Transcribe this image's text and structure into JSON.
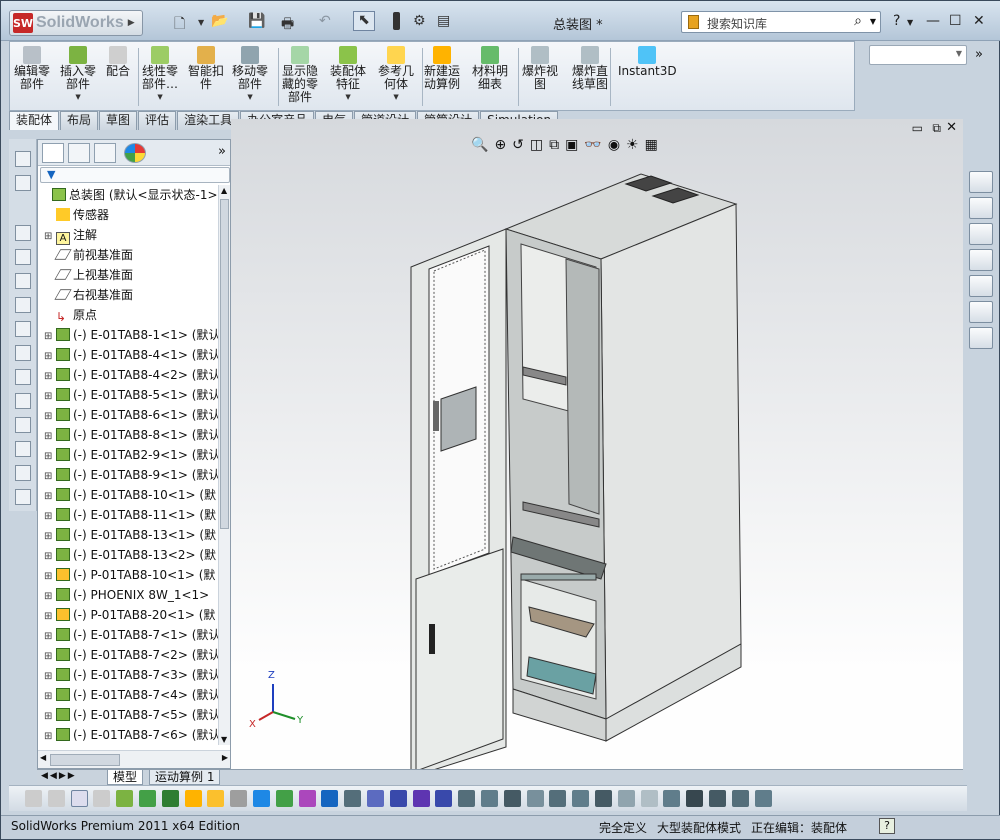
{
  "app": {
    "logo_text": "SolidWorks",
    "logo_mark": "SW",
    "doc_title": "总装图 *"
  },
  "search": {
    "placeholder": "搜索知识库"
  },
  "commands": [
    {
      "label": "编辑零\n部件",
      "icon": "edit-component-icon",
      "has_dropdown": false
    },
    {
      "label": "插入零\n部件",
      "icon": "insert-component-icon",
      "has_dropdown": true
    },
    {
      "label": "配合",
      "icon": "mate-icon",
      "has_dropdown": false
    },
    {
      "label": "线性零\n部件…",
      "icon": "linear-pattern-icon",
      "has_dropdown": true
    },
    {
      "label": "智能扣\n件",
      "icon": "smart-fastener-icon",
      "has_dropdown": false
    },
    {
      "label": "移动零\n部件",
      "icon": "move-component-icon",
      "has_dropdown": true
    },
    {
      "label": "显示隐\n藏的零\n部件",
      "icon": "show-hidden-icon",
      "has_dropdown": false
    },
    {
      "label": "装配体\n特征",
      "icon": "assembly-feature-icon",
      "has_dropdown": true
    },
    {
      "label": "参考几\n何体",
      "icon": "reference-geometry-icon",
      "has_dropdown": true
    },
    {
      "label": "新建运\n动算例",
      "icon": "new-motion-study-icon",
      "has_dropdown": false
    },
    {
      "label": "材料明\n细表",
      "icon": "bill-of-materials-icon",
      "has_dropdown": false
    },
    {
      "label": "爆炸视\n图",
      "icon": "exploded-view-icon",
      "has_dropdown": false
    },
    {
      "label": "爆炸直\n线草图",
      "icon": "explode-line-sketch-icon",
      "has_dropdown": false
    },
    {
      "label": "Instant3D",
      "icon": "instant3d-icon",
      "has_dropdown": false
    }
  ],
  "tabs": [
    "装配体",
    "布局",
    "草图",
    "评估",
    "渲染工具",
    "办公室产品",
    "电气",
    "管道设计",
    "管筒设计",
    "Simulation"
  ],
  "active_tab": "装配体",
  "tree": [
    {
      "label": "总装图 (默认<显示状态-1>)",
      "icon": "assembly-icon",
      "level": 0,
      "expandable": false
    },
    {
      "label": "传感器",
      "icon": "sensor-icon",
      "level": 1,
      "expandable": false
    },
    {
      "label": "注解",
      "icon": "annotation-icon",
      "level": 1,
      "expandable": true
    },
    {
      "label": "前视基准面",
      "icon": "plane-icon",
      "level": 1,
      "expandable": false
    },
    {
      "label": "上视基准面",
      "icon": "plane-icon",
      "level": 1,
      "expandable": false
    },
    {
      "label": "右视基准面",
      "icon": "plane-icon",
      "level": 1,
      "expandable": false
    },
    {
      "label": "原点",
      "icon": "origin-icon",
      "level": 1,
      "expandable": false
    },
    {
      "label": "(-) E-01TAB8-1<1> (默认",
      "icon": "part-icon",
      "level": 1,
      "expandable": true
    },
    {
      "label": "(-) E-01TAB8-4<1> (默认",
      "icon": "part-icon",
      "level": 1,
      "expandable": true
    },
    {
      "label": "(-) E-01TAB8-4<2> (默认",
      "icon": "part-icon",
      "level": 1,
      "expandable": true
    },
    {
      "label": "(-) E-01TAB8-5<1> (默认",
      "icon": "part-icon",
      "level": 1,
      "expandable": true
    },
    {
      "label": "(-) E-01TAB8-6<1> (默认",
      "icon": "part-icon",
      "level": 1,
      "expandable": true
    },
    {
      "label": "(-) E-01TAB8-8<1> (默认",
      "icon": "part-icon",
      "level": 1,
      "expandable": true
    },
    {
      "label": "(-) E-01TAB2-9<1> (默认",
      "icon": "part-icon",
      "level": 1,
      "expandable": true
    },
    {
      "label": "(-) E-01TAB8-9<1> (默认",
      "icon": "part-icon",
      "level": 1,
      "expandable": true
    },
    {
      "label": "(-) E-01TAB8-10<1> (默",
      "icon": "part-icon",
      "level": 1,
      "expandable": true
    },
    {
      "label": "(-) E-01TAB8-11<1> (默",
      "icon": "part-icon",
      "level": 1,
      "expandable": true
    },
    {
      "label": "(-) E-01TAB8-13<1> (默",
      "icon": "part-icon",
      "level": 1,
      "expandable": true
    },
    {
      "label": "(-) E-01TAB8-13<2> (默",
      "icon": "part-icon",
      "level": 1,
      "expandable": true
    },
    {
      "label": "(-) P-01TAB8-10<1> (默",
      "icon": "part-yellow-icon",
      "level": 1,
      "expandable": true
    },
    {
      "label": "(-) PHOENIX 8W_1<1>",
      "icon": "part-icon",
      "level": 1,
      "expandable": true
    },
    {
      "label": "(-) P-01TAB8-20<1> (默",
      "icon": "part-yellow-icon",
      "level": 1,
      "expandable": true
    },
    {
      "label": "(-) E-01TAB8-7<1> (默认",
      "icon": "part-icon",
      "level": 1,
      "expandable": true
    },
    {
      "label": "(-) E-01TAB8-7<2> (默认",
      "icon": "part-icon",
      "level": 1,
      "expandable": true
    },
    {
      "label": "(-) E-01TAB8-7<3> (默认",
      "icon": "part-icon",
      "level": 1,
      "expandable": true
    },
    {
      "label": "(-) E-01TAB8-7<4> (默认",
      "icon": "part-icon",
      "level": 1,
      "expandable": true
    },
    {
      "label": "(-) E-01TAB8-7<5> (默认",
      "icon": "part-icon",
      "level": 1,
      "expandable": true
    },
    {
      "label": "(-) E-01TAB8-7<6> (默认",
      "icon": "part-icon",
      "level": 1,
      "expandable": true
    }
  ],
  "bottom_tabs": [
    "模型",
    "运动算例 1"
  ],
  "status": {
    "edition": "SolidWorks Premium 2011 x64 Edition",
    "defined": "完全定义",
    "mode": "大型装配体模式",
    "editing": "正在编辑：装配体"
  },
  "triad": {
    "x": "X",
    "y": "Y",
    "z": "Z"
  },
  "colors": {
    "accent": "#1565c0",
    "part_green": "#7cb342",
    "logo_red": "#c62828"
  }
}
